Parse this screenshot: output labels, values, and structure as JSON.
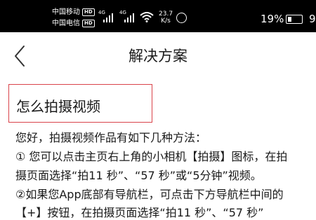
{
  "status_bar": {
    "carrier1": "中国移动",
    "carrier2": "中国电信",
    "hd_badge": "HD",
    "network1": "4G",
    "network2": "4G",
    "speed_value": "23.7",
    "speed_unit": "K/s",
    "battery_percent": "19%",
    "time": "9"
  },
  "header": {
    "title": "解决方案"
  },
  "article": {
    "question": "怎么拍摄视频",
    "lines": [
      "您好，拍摄视频作品有如下几种方法：",
      "① 您可以点击主页右上角的小相机【拍摄】图标，在拍",
      "摄页面选择“拍11 秒”、“57 秒”或“5分钟”视频。",
      "②如果您App底部有导航栏，可点击下方导航栏中间的",
      "【+】按钮，在拍摄页面选择“拍11 秒”、“57 秒”"
    ]
  }
}
